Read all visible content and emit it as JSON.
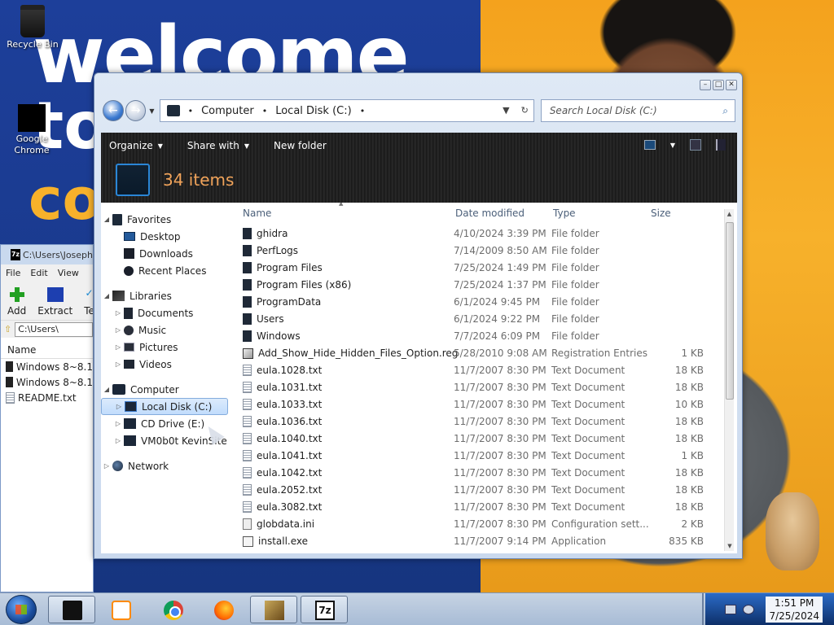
{
  "desktop": {
    "icons": [
      {
        "label": "Recycle Bin"
      },
      {
        "label": "Google Chrome"
      }
    ]
  },
  "zip_window": {
    "title": "C:\\Users\\Joseph",
    "menu": [
      "File",
      "Edit",
      "View"
    ],
    "tools": [
      "Add",
      "Extract",
      "Te"
    ],
    "address": "C:\\Users\\",
    "column_name": "Name",
    "files": [
      "Windows 8~8.1",
      "Windows 8~8.1",
      "README.txt"
    ]
  },
  "explorer": {
    "breadcrumb": [
      "Computer",
      "Local Disk (C:)"
    ],
    "search_placeholder": "Search Local Disk (C:)",
    "toolbar": {
      "organize": "Organize",
      "share_with": "Share with",
      "new_folder": "New folder"
    },
    "item_count": "34 items",
    "nav": {
      "favorites": "Favorites",
      "favorites_items": [
        "Desktop",
        "Downloads",
        "Recent Places"
      ],
      "libraries": "Libraries",
      "libraries_items": [
        "Documents",
        "Music",
        "Pictures",
        "Videos"
      ],
      "computer": "Computer",
      "computer_items": [
        "Local Disk (C:)",
        "CD Drive (E:)",
        "VM0b0t KevinSite"
      ],
      "network": "Network"
    },
    "columns": {
      "name": "Name",
      "date": "Date modified",
      "type": "Type",
      "size": "Size"
    },
    "files": [
      {
        "name": "ghidra",
        "date": "4/10/2024 3:39 PM",
        "type": "File folder",
        "size": "",
        "icon": "folder-icon"
      },
      {
        "name": "PerfLogs",
        "date": "7/14/2009 8:50 AM",
        "type": "File folder",
        "size": "",
        "icon": "folder-icon"
      },
      {
        "name": "Program Files",
        "date": "7/25/2024 1:49 PM",
        "type": "File folder",
        "size": "",
        "icon": "folder-icon"
      },
      {
        "name": "Program Files (x86)",
        "date": "7/25/2024 1:37 PM",
        "type": "File folder",
        "size": "",
        "icon": "folder-icon"
      },
      {
        "name": "ProgramData",
        "date": "6/1/2024 9:45 PM",
        "type": "File folder",
        "size": "",
        "icon": "folder-icon"
      },
      {
        "name": "Users",
        "date": "6/1/2024 9:22 PM",
        "type": "File folder",
        "size": "",
        "icon": "folder-icon"
      },
      {
        "name": "Windows",
        "date": "7/7/2024 6:09 PM",
        "type": "File folder",
        "size": "",
        "icon": "folder-icon"
      },
      {
        "name": "Add_Show_Hide_Hidden_Files_Option.reg",
        "date": "5/28/2010 9:08 AM",
        "type": "Registration Entries",
        "size": "1 KB",
        "icon": "registry-icon"
      },
      {
        "name": "eula.1028.txt",
        "date": "11/7/2007 8:30 PM",
        "type": "Text Document",
        "size": "18 KB",
        "icon": "text-file-icon"
      },
      {
        "name": "eula.1031.txt",
        "date": "11/7/2007 8:30 PM",
        "type": "Text Document",
        "size": "18 KB",
        "icon": "text-file-icon"
      },
      {
        "name": "eula.1033.txt",
        "date": "11/7/2007 8:30 PM",
        "type": "Text Document",
        "size": "10 KB",
        "icon": "text-file-icon"
      },
      {
        "name": "eula.1036.txt",
        "date": "11/7/2007 8:30 PM",
        "type": "Text Document",
        "size": "18 KB",
        "icon": "text-file-icon"
      },
      {
        "name": "eula.1040.txt",
        "date": "11/7/2007 8:30 PM",
        "type": "Text Document",
        "size": "18 KB",
        "icon": "text-file-icon"
      },
      {
        "name": "eula.1041.txt",
        "date": "11/7/2007 8:30 PM",
        "type": "Text Document",
        "size": "1 KB",
        "icon": "text-file-icon"
      },
      {
        "name": "eula.1042.txt",
        "date": "11/7/2007 8:30 PM",
        "type": "Text Document",
        "size": "18 KB",
        "icon": "text-file-icon"
      },
      {
        "name": "eula.2052.txt",
        "date": "11/7/2007 8:30 PM",
        "type": "Text Document",
        "size": "18 KB",
        "icon": "text-file-icon"
      },
      {
        "name": "eula.3082.txt",
        "date": "11/7/2007 8:30 PM",
        "type": "Text Document",
        "size": "18 KB",
        "icon": "text-file-icon"
      },
      {
        "name": "globdata.ini",
        "date": "11/7/2007 8:30 PM",
        "type": "Configuration sett...",
        "size": "2 KB",
        "icon": "config-file-icon"
      },
      {
        "name": "install.exe",
        "date": "11/7/2007 9:14 PM",
        "type": "Application",
        "size": "835 KB",
        "icon": "application-icon"
      }
    ]
  },
  "taskbar": {
    "time": "1:51 PM",
    "date": "7/25/2024",
    "seven_zip_label": "7z"
  }
}
